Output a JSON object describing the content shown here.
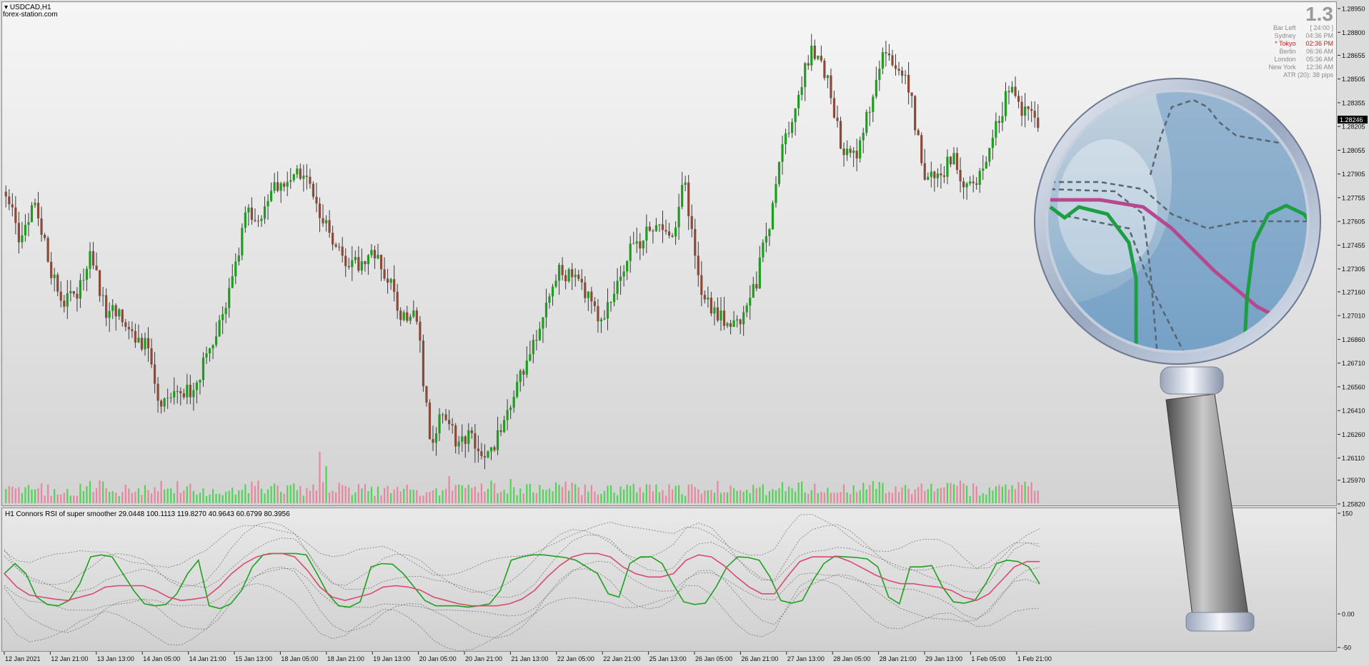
{
  "window": {
    "symbol": "USDCAD,H1",
    "source": "forex-station.com"
  },
  "indicator": {
    "label": "H1 Connors RSI of super smoother 29.0448 100.1113 119.8270 40.9643 60.6799 80.3956"
  },
  "info_panel": {
    "big_value": "1.3",
    "rows": [
      {
        "label": "Bar Left",
        "value": "[ 24:00 ]"
      },
      {
        "label": "Sydney",
        "value": "04:36 PM"
      },
      {
        "label": "* Tokyo",
        "value": "02:36 PM",
        "highlight": true
      },
      {
        "label": "Berlin",
        "value": "06:36 AM"
      },
      {
        "label": "London",
        "value": "05:36 AM"
      },
      {
        "label": "New York",
        "value": "12:36 AM"
      }
    ],
    "atr": "ATR (20): 38 pips"
  },
  "chart_data": [
    {
      "type": "candlestick",
      "title": "USDCAD,H1",
      "ylim": [
        1.2582,
        1.2895
      ],
      "y_ticks": [
        "1.28950",
        "1.28800",
        "1.28655",
        "1.28505",
        "1.28355",
        "1.28205",
        "1.28055",
        "1.27905",
        "1.27755",
        "1.27605",
        "1.27455",
        "1.27305",
        "1.27160",
        "1.27010",
        "1.26860",
        "1.26710",
        "1.26560",
        "1.26410",
        "1.26260",
        "1.26110",
        "1.25970",
        "1.25820"
      ],
      "current_price": "1.28246",
      "x_ticks": [
        "12 Jan 2021",
        "12 Jan 21:00",
        "13 Jan 13:00",
        "14 Jan 05:00",
        "14 Jan 21:00",
        "15 Jan 13:00",
        "18 Jan 05:00",
        "18 Jan 21:00",
        "19 Jan 13:00",
        "20 Jan 05:00",
        "20 Jan 21:00",
        "21 Jan 13:00",
        "22 Jan 05:00",
        "22 Jan 21:00",
        "25 Jan 13:00",
        "26 Jan 05:00",
        "26 Jan 21:00",
        "27 Jan 13:00",
        "28 Jan 05:00",
        "28 Jan 21:00",
        "29 Jan 13:00",
        "1 Feb 05:00",
        "1 Feb 21:00"
      ],
      "close_path": [
        1.278,
        1.2745,
        1.2775,
        1.2735,
        1.271,
        1.2712,
        1.274,
        1.2705,
        1.27,
        1.269,
        1.268,
        1.264,
        1.266,
        1.265,
        1.267,
        1.269,
        1.272,
        1.2765,
        1.276,
        1.2785,
        1.278,
        1.2795,
        1.2768,
        1.2752,
        1.273,
        1.2735,
        1.274,
        1.2725,
        1.27,
        1.2705,
        1.262,
        1.264,
        1.262,
        1.2625,
        1.261,
        1.263,
        1.265,
        1.268,
        1.27,
        1.273,
        1.2725,
        1.2715,
        1.27,
        1.271,
        1.274,
        1.275,
        1.276,
        1.2745,
        1.2785,
        1.272,
        1.2705,
        1.2695,
        1.27,
        1.272,
        1.276,
        1.281,
        1.284,
        1.287,
        1.2855,
        1.281,
        1.28,
        1.283,
        1.2868,
        1.286,
        1.284,
        1.2785,
        1.279,
        1.28,
        1.278,
        1.279,
        1.282,
        1.2845,
        1.283,
        1.2825
      ],
      "colors": {
        "bull": "#1e9e1e",
        "bear": "#8a4a3a",
        "wick": "#3a3a3a"
      }
    },
    {
      "type": "histogram",
      "title": "volume",
      "colors": {
        "up": "#44d34a",
        "down": "#e87e9a"
      }
    },
    {
      "type": "line",
      "title": "H1 Connors RSI of super smoother 29.0448 100.1113 119.8270 40.9643 60.6799 80.3956",
      "ylim": [
        -50,
        150
      ],
      "y_ticks": [
        "150",
        "0.00",
        "-50"
      ],
      "series": [
        {
          "name": "Connors RSI",
          "color": "#1fa11f",
          "values": [
            60,
            75,
            60,
            25,
            14,
            12,
            20,
            45,
            85,
            88,
            85,
            60,
            35,
            15,
            12,
            14,
            30,
            60,
            80,
            12,
            8,
            15,
            35,
            70,
            88,
            90,
            90,
            90,
            88,
            60,
            30,
            12,
            10,
            18,
            70,
            75,
            74,
            60,
            40,
            20,
            12,
            12,
            12,
            10,
            12,
            15,
            35,
            80,
            85,
            88,
            88,
            86,
            84,
            80,
            70,
            60,
            30,
            25,
            75,
            85,
            85,
            75,
            45,
            18,
            14,
            16,
            40,
            70,
            85,
            84,
            80,
            55,
            20,
            16,
            20,
            50,
            75,
            86,
            85,
            84,
            82,
            70,
            25,
            15,
            70,
            70,
            72,
            40,
            18,
            16,
            20,
            45,
            75,
            80,
            78,
            70,
            45
          ]
        },
        {
          "name": "super smoother",
          "color": "#d84a72",
          "values": [
            60,
            40,
            28,
            25,
            22,
            20,
            25,
            30,
            40,
            42,
            42,
            42,
            35,
            25,
            20,
            22,
            25,
            40,
            60,
            75,
            85,
            90,
            90,
            85,
            65,
            40,
            25,
            20,
            25,
            30,
            40,
            42,
            40,
            35,
            25,
            20,
            15,
            12,
            12,
            12,
            15,
            22,
            35,
            55,
            72,
            85,
            90,
            90,
            85,
            70,
            60,
            55,
            55,
            60,
            80,
            88,
            85,
            72,
            55,
            40,
            30,
            30,
            55,
            78,
            85,
            85,
            85,
            78,
            68,
            58,
            50,
            45,
            45,
            42,
            40,
            35,
            25,
            20,
            30,
            50,
            70,
            78,
            78
          ]
        }
      ]
    }
  ],
  "magnifier": {
    "description_colors": {
      "ring": "#b9c4d6",
      "lens": "#8fb2cf",
      "green": "#1d9e43",
      "magenta": "#b8488d"
    }
  }
}
